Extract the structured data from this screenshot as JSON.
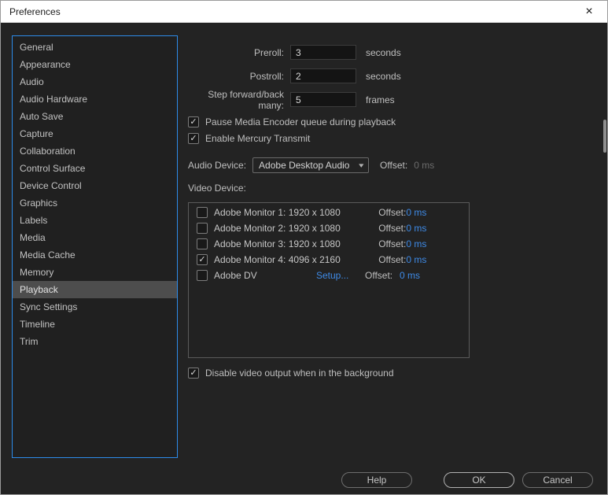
{
  "window": {
    "title": "Preferences"
  },
  "icons": {
    "close": "×",
    "chevron_down": "▾",
    "check": "✓"
  },
  "sidebar": {
    "items": [
      {
        "label": "General",
        "selected": false
      },
      {
        "label": "Appearance",
        "selected": false
      },
      {
        "label": "Audio",
        "selected": false
      },
      {
        "label": "Audio Hardware",
        "selected": false
      },
      {
        "label": "Auto Save",
        "selected": false
      },
      {
        "label": "Capture",
        "selected": false
      },
      {
        "label": "Collaboration",
        "selected": false
      },
      {
        "label": "Control Surface",
        "selected": false
      },
      {
        "label": "Device Control",
        "selected": false
      },
      {
        "label": "Graphics",
        "selected": false
      },
      {
        "label": "Labels",
        "selected": false
      },
      {
        "label": "Media",
        "selected": false
      },
      {
        "label": "Media Cache",
        "selected": false
      },
      {
        "label": "Memory",
        "selected": false
      },
      {
        "label": "Playback",
        "selected": true
      },
      {
        "label": "Sync Settings",
        "selected": false
      },
      {
        "label": "Timeline",
        "selected": false
      },
      {
        "label": "Trim",
        "selected": false
      }
    ]
  },
  "playback": {
    "preroll": {
      "label": "Preroll:",
      "value": "3",
      "unit": "seconds"
    },
    "postroll": {
      "label": "Postroll:",
      "value": "2",
      "unit": "seconds"
    },
    "step": {
      "label": "Step forward/back many:",
      "value": "5",
      "unit": "frames"
    },
    "pause_encoder": {
      "label": "Pause Media Encoder queue during playback",
      "checked": true
    },
    "mercury": {
      "label": "Enable Mercury Transmit",
      "checked": true
    },
    "audio_device": {
      "label": "Audio Device:",
      "value": "Adobe Desktop Audio",
      "offset_label": "Offset:",
      "offset_value": "0 ms"
    },
    "video_device": {
      "label": "Video Device:",
      "rows": [
        {
          "name": "Adobe Monitor 1: 1920 x 1080",
          "checked": false,
          "setup": "",
          "offset_label": "Offset:",
          "offset_value": "0 ms"
        },
        {
          "name": "Adobe Monitor 2: 1920 x 1080",
          "checked": false,
          "setup": "",
          "offset_label": "Offset:",
          "offset_value": "0 ms"
        },
        {
          "name": "Adobe Monitor 3: 1920 x 1080",
          "checked": false,
          "setup": "",
          "offset_label": "Offset:",
          "offset_value": "0 ms"
        },
        {
          "name": "Adobe Monitor 4: 4096 x 2160",
          "checked": true,
          "setup": "",
          "offset_label": "Offset:",
          "offset_value": "0 ms"
        },
        {
          "name": "Adobe DV",
          "checked": false,
          "setup": "Setup...",
          "offset_label": "Offset:",
          "offset_value": "0 ms"
        }
      ]
    },
    "disable_background": {
      "label": "Disable video output when in the background",
      "checked": true
    }
  },
  "footer": {
    "help": "Help",
    "ok": "OK",
    "cancel": "Cancel"
  },
  "colors": {
    "accent": "#2d8ceb",
    "hot_text": "#3e8ae6"
  }
}
